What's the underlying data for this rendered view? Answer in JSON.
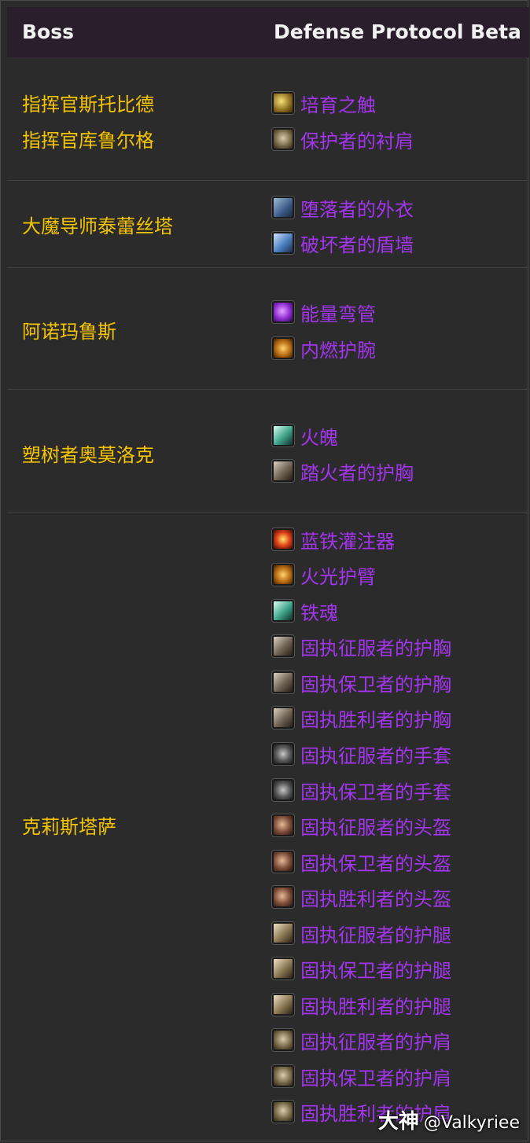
{
  "header": {
    "boss_col": "Boss",
    "loot_col": "Defense Protocol Beta"
  },
  "bosses": [
    "指挥官斯托比德",
    "指挥官库鲁尔格",
    "大魔导师泰蕾丝塔",
    "阿诺玛鲁斯",
    "塑树者奥莫洛克",
    "克莉斯塔萨"
  ],
  "items": [
    {
      "name": "培育之触",
      "icon": "rune-icon"
    },
    {
      "name": "保护者的衬肩",
      "icon": "shoulder-icon"
    },
    {
      "name": "堕落者的外衣",
      "icon": "robe-icon"
    },
    {
      "name": "破坏者的盾墙",
      "icon": "shield-icon"
    },
    {
      "name": "能量弯管",
      "icon": "orb-icon"
    },
    {
      "name": "内燃护腕",
      "icon": "bracer-icon"
    },
    {
      "name": "火魄",
      "icon": "dagger-icon"
    },
    {
      "name": "踏火者的护胸",
      "icon": "chest-icon"
    },
    {
      "name": "蓝铁灌注器",
      "icon": "fire-orb-icon"
    },
    {
      "name": "火光护臂",
      "icon": "bracer-icon"
    },
    {
      "name": "铁魂",
      "icon": "dagger-icon"
    },
    {
      "name": "固执征服者的护胸",
      "icon": "chest-icon"
    },
    {
      "name": "固执保卫者的护胸",
      "icon": "chest-icon"
    },
    {
      "name": "固执胜利者的护胸",
      "icon": "chest-icon"
    },
    {
      "name": "固执征服者的手套",
      "icon": "gloves-icon"
    },
    {
      "name": "固执保卫者的手套",
      "icon": "gloves-icon"
    },
    {
      "name": "固执征服者的头盔",
      "icon": "helm-icon"
    },
    {
      "name": "固执保卫者的头盔",
      "icon": "helm-icon"
    },
    {
      "name": "固执胜利者的头盔",
      "icon": "helm-icon"
    },
    {
      "name": "固执征服者的护腿",
      "icon": "legs-icon"
    },
    {
      "name": "固执保卫者的护腿",
      "icon": "legs-icon"
    },
    {
      "name": "固执胜利者的护腿",
      "icon": "legs-icon"
    },
    {
      "name": "固执征服者的护肩",
      "icon": "shoulder-icon"
    },
    {
      "name": "固执保卫者的护肩",
      "icon": "shoulder-icon"
    },
    {
      "name": "固执胜利者的护肩",
      "icon": "shoulder-icon"
    }
  ],
  "colors": {
    "boss": "#f5c400",
    "epic": "#a335ee",
    "header_bg": "#2a1e2c",
    "body_bg": "#2b2b2b"
  },
  "watermark": {
    "logo": "大神",
    "handle": "@Valkyriee"
  }
}
